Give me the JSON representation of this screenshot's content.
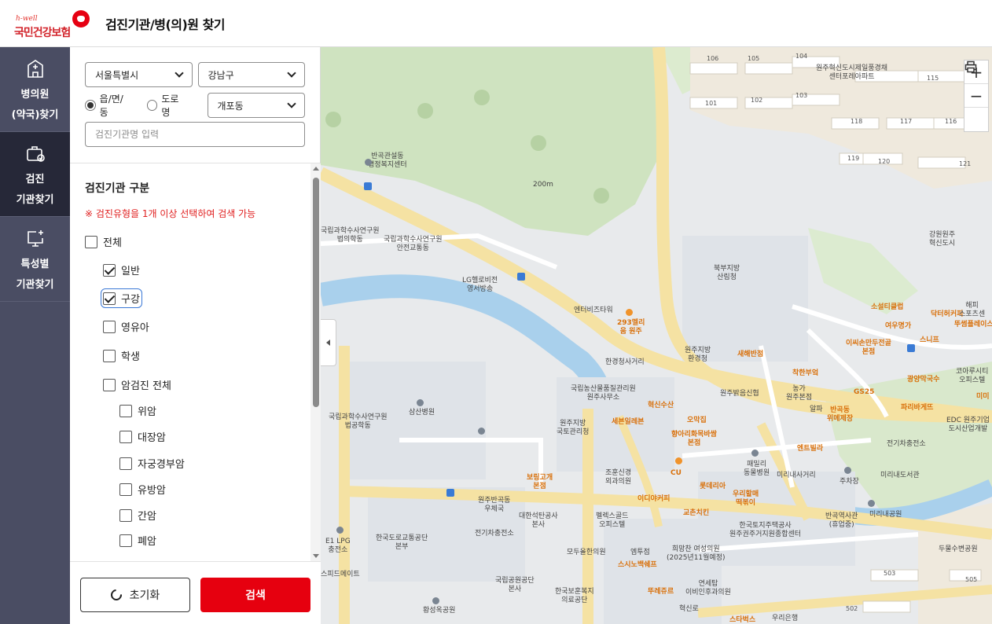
{
  "header": {
    "logo_small": "h-well",
    "logo_name": "국민건강보험",
    "title": "검진기관/병(의)원 찾기"
  },
  "leftnav": {
    "items": [
      {
        "line1": "병의원",
        "line2": "(약국)찾기",
        "icon": "hospital-icon"
      },
      {
        "line1": "검진",
        "line2": "기관찾기",
        "icon": "checkup-icon"
      },
      {
        "line1": "특성별",
        "line2": "기관찾기",
        "icon": "monitor-plus-icon"
      }
    ]
  },
  "filters": {
    "city": "서울특별시",
    "district": "강남구",
    "radio_dong": "읍/면/동",
    "radio_road": "도로명",
    "dong": "개포동",
    "name_placeholder": "검진기관명 입력"
  },
  "category": {
    "title": "검진기관 구분",
    "notice": "※ 검진유형을 1개 이상 선택하여 검색 가능",
    "all": "전체",
    "items": [
      "일반",
      "구강",
      "영유아",
      "학생",
      "암검진 전체"
    ],
    "cancer_items": [
      "위암",
      "대장암",
      "자궁경부암",
      "유방암",
      "간암",
      "폐암"
    ]
  },
  "buttons": {
    "reset": "초기화",
    "search": "검색"
  },
  "map": {
    "zoom_in": "+",
    "zoom_out": "−",
    "labels": {
      "l1": "반곡관설동\n행정복지센터",
      "l2": "국립과학수사연구원\n법의학동",
      "l3": "국립과학수사연구원\n안전교통동",
      "l4": "LG헬로비전\n영서방송",
      "l5": "북부지방\n산림청",
      "l6": "엔터비즈타워",
      "l7": "293멜리\n움 원주",
      "l8": "원주지방\n환경청",
      "l9": "한경청사거리",
      "l10": "국립농산물품질관리원\n원주사무소",
      "l11": "국립과학수사연구원\n법공학동",
      "l12": "삼산병원",
      "l13": "원주지방\n국토관리청",
      "l14": "혁신수산",
      "l15": "세븐일레븐",
      "l16": "오막집",
      "l17": "향아리화목바쌈\n본점",
      "l18": "원주밝음신협",
      "l19": "새해반점",
      "l20": "착한부엌",
      "l21": "농가\n원주본점",
      "l22": "알파",
      "l23": "반곡동\n위메제장",
      "l24": "엔트빌라",
      "l25": "패밀리\n동물병원",
      "l26": "미리내사거리",
      "l27": "조훈신경\n외과의원",
      "l28": "CU",
      "l29": "보링고개\n본점",
      "l30": "원주반곡동\n우체국",
      "l31": "대한석탄공사\n본사",
      "l32": "한국도로교통공단\n본부",
      "l33": "전기차충전소",
      "l34": "펠렉스골드\n오피스텔",
      "l35": "엠투점",
      "l36": "모두올한의원",
      "l37": "희망찬 여성의원\n(2025년11월예정)",
      "l38": "스시노백쉐프",
      "l39": "이디야커피",
      "l40": "교촌치킨",
      "l41": "우리할매\n떡볶이",
      "l42": "롯데리아",
      "l43": "한국토지주택공사\n원주권주거지원종합센터",
      "l44": "반곡역사관\n(휴업중)",
      "l45": "주차장",
      "l46": "미리내공원",
      "l47": "미리내도서관",
      "l48": "전기차충전소",
      "l49": "국립공원공단\n본사",
      "l50": "한국보훈복지\n의료공단",
      "l51": "뚜레쥬르",
      "l52": "연세탑\n이비인후과의원",
      "l53": "황성옥공원",
      "l54": "E1 LPG\n충전소",
      "l55": "스피드메이트",
      "l56": "소설티클럽",
      "l57": "닥터허커피",
      "l58": "여우명가",
      "l59": "이씨손만두전골\n본점",
      "l60": "스니프",
      "l61": "광양막국수",
      "l62": "GS25",
      "l63": "파리바게뜨",
      "l64": "코아루시티\n오피스텔",
      "l65": "EDC 원주기업\n도시산업개발",
      "l66": "원주혁신도시제일풍경채\n센터포레아파트",
      "l67": "강원원주\n혁신도시",
      "l68": "해피\n스포츠센",
      "l69": "뚜썸플레이스",
      "l70": "미미",
      "l71": "두물수변공원",
      "l72": "스타벅스",
      "l73": "우리은행",
      "l74": "혁신로",
      "l75": "200m"
    },
    "buildings": [
      "106",
      "105",
      "104",
      "115",
      "103",
      "101",
      "102",
      "118",
      "117",
      "116",
      "119",
      "120",
      "121",
      "505",
      "503",
      "502"
    ]
  }
}
